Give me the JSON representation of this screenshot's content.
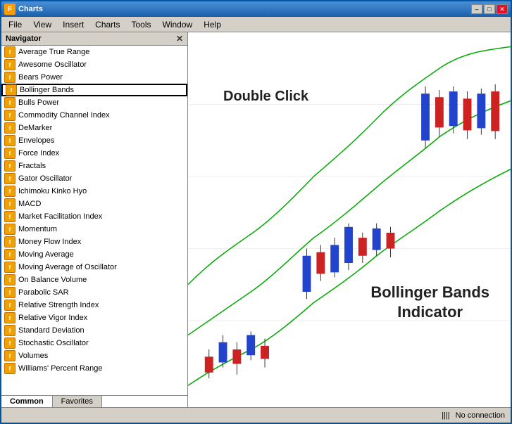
{
  "window": {
    "title": "Charts",
    "title_icon": "F"
  },
  "menu": {
    "items": [
      "File",
      "View",
      "Insert",
      "Charts",
      "Tools",
      "Window",
      "Help"
    ]
  },
  "navigator": {
    "header": "Navigator",
    "indicators": [
      "Average True Range",
      "Awesome Oscillator",
      "Bears Power",
      "Bollinger Bands",
      "Bulls Power",
      "Commodity Channel Index",
      "DeMarker",
      "Envelopes",
      "Force Index",
      "Fractals",
      "Gator Oscillator",
      "Ichimoku Kinko Hyo",
      "MACD",
      "Market Facilitation Index",
      "Momentum",
      "Money Flow Index",
      "Moving Average",
      "Moving Average of Oscillator",
      "On Balance Volume",
      "Parabolic SAR",
      "Relative Strength Index",
      "Relative Vigor Index",
      "Standard Deviation",
      "Stochastic Oscillator",
      "Volumes",
      "Williams' Percent Range"
    ],
    "selected_index": 3,
    "tabs": [
      "Common",
      "Favorites"
    ]
  },
  "chart": {
    "double_click_label": "Double Click",
    "bollinger_label": "Bollinger Bands\nIndicator"
  },
  "status": {
    "connection": "No connection",
    "bars_icon": "||||"
  }
}
